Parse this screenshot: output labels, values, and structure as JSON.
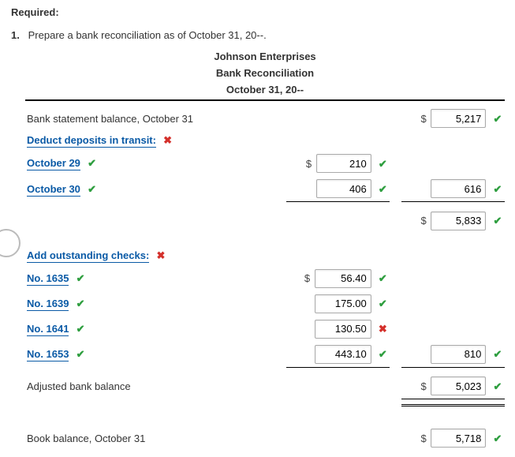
{
  "heading": "Required:",
  "instruction_num": "1.",
  "instruction": "Prepare a bank reconciliation as of October 31, 20--.",
  "titles": {
    "company": "Johnson Enterprises",
    "report": "Bank Reconciliation",
    "date": "October 31, 20--"
  },
  "rows": {
    "bank_stmt_label": "Bank statement balance, October 31",
    "bank_stmt_value": "5,217",
    "section1_label": "Deduct deposits in transit:",
    "dep1_label": "October 29",
    "dep1_value": "210",
    "dep2_label": "October 30",
    "dep2_value": "406",
    "dep_subtotal": "616",
    "after_deposits": "5,833",
    "section2_label": "Add outstanding checks:",
    "chk1_label": "No. 1635",
    "chk1_value": "56.40",
    "chk2_label": "No. 1639",
    "chk2_value": "175.00",
    "chk3_label": "No. 1641",
    "chk3_value": "130.50",
    "chk4_label": "No. 1653",
    "chk4_value": "443.10",
    "chk_subtotal": "810",
    "adj_bank_label": "Adjusted bank balance",
    "adj_bank_value": "5,023",
    "book_label": "Book balance, October 31",
    "book_value": "5,718"
  },
  "marks": {
    "check": "✔",
    "cross": "✖"
  },
  "symbols": {
    "dollar": "$"
  }
}
